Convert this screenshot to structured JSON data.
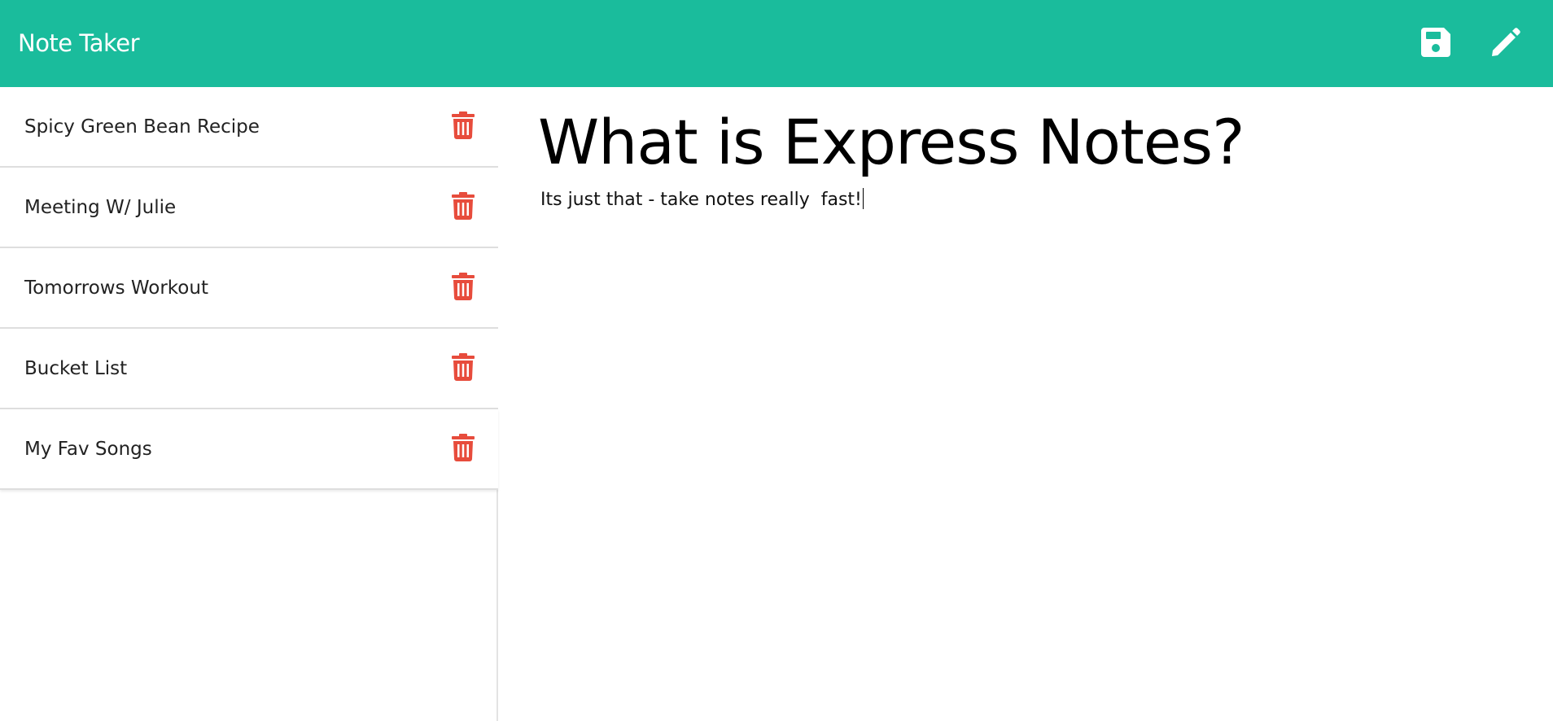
{
  "app": {
    "title": "Note Taker",
    "accent_color": "#1abc9c",
    "delete_color": "#e74c3c"
  },
  "toolbar": {
    "save_icon": "floppy-disk-save-icon",
    "new_note_icon": "pencil-icon"
  },
  "sidebar": {
    "notes": [
      {
        "title": "Spicy Green Bean Recipe",
        "icon": "trash-icon"
      },
      {
        "title": "Meeting W/ Julie",
        "icon": "trash-icon"
      },
      {
        "title": "Tomorrows Workout",
        "icon": "trash-icon"
      },
      {
        "title": "Bucket List",
        "icon": "trash-icon"
      },
      {
        "title": "My Fav Songs",
        "icon": "trash-icon"
      }
    ]
  },
  "editor": {
    "title": "What is Express Notes?",
    "body": "Its just that - take notes really  fast!"
  }
}
